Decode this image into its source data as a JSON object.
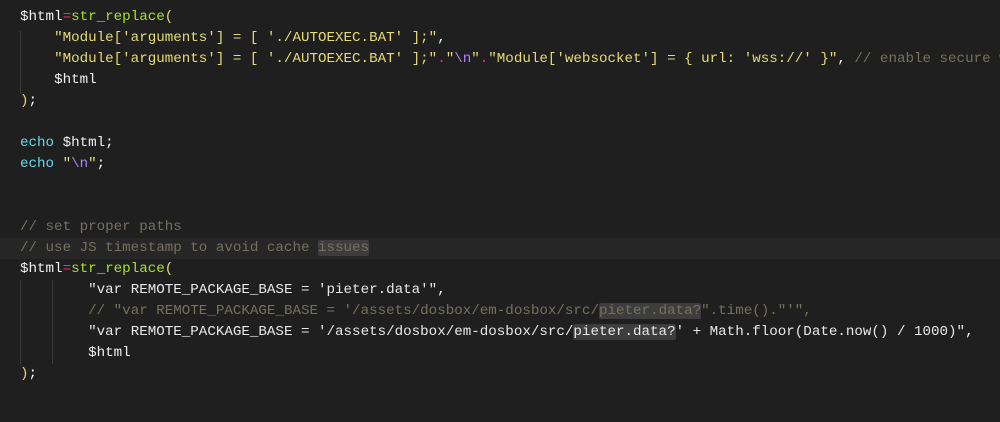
{
  "editor": {
    "code": {
      "line_1": {
        "var": "$html",
        "op": "=",
        "fn": "str_replace",
        "paren": "("
      },
      "line_2": {
        "str": "\"Module['arguments'] = [ './AUTOEXEC.BAT' ];\"",
        "punct": ","
      },
      "line_3": {
        "str1": "\"Module['arguments'] = [ './AUTOEXEC.BAT' ];\"",
        "dot1": ".",
        "str2a": "\"",
        "esc": "\\n",
        "str2b": "\"",
        "dot2": ".",
        "str3": "\"Module['websocket'] = { url: 'wss://' }\"",
        "punct": ",",
        "comment": "// enable secure w"
      },
      "line_4": {
        "var": "$html"
      },
      "line_5": {
        "close": ")",
        "semi": ";"
      },
      "line_7": {
        "kw": "echo",
        "var": "$html",
        "semi": ";"
      },
      "line_8": {
        "kw": "echo",
        "str_open": "\"",
        "esc": "\\n",
        "str_close": "\"",
        "semi": ";"
      },
      "line_11": {
        "comment": "// set proper paths"
      },
      "line_12": {
        "comment_a": "// use JS timestamp to avoid cache ",
        "comment_match": "issues"
      },
      "line_13": {
        "var": "$html",
        "op": "=",
        "fn": "str_replace",
        "paren": "("
      },
      "line_14": {
        "str": "\"var REMOTE_PACKAGE_BASE = 'pieter.data'\"",
        "punct": ","
      },
      "line_15": {
        "a": "// \"var REMOTE_PACKAGE_BASE = '/assets/dosbox/em-dosbox/src/",
        "match": "pieter.data?",
        "b": "\".time().\"'\","
      },
      "line_16": {
        "a": "\"var REMOTE_PACKAGE_BASE = '/assets/dosbox/em-dosbox/src/",
        "match": "pieter.data?",
        "b": "' + Math.floor(Date.now() / 1000)\"",
        "punct": ","
      },
      "line_17": {
        "var": "$html"
      },
      "line_18": {
        "close": ")",
        "semi": ";"
      }
    },
    "colors": {
      "background": "#1f1f1f",
      "variable": "#f0f0f0",
      "operator": "#f92672",
      "function": "#a6e22e",
      "string": "#e6db74",
      "keyword": "#66d9ef",
      "escape": "#ae81ff",
      "comment": "#75715e"
    }
  }
}
